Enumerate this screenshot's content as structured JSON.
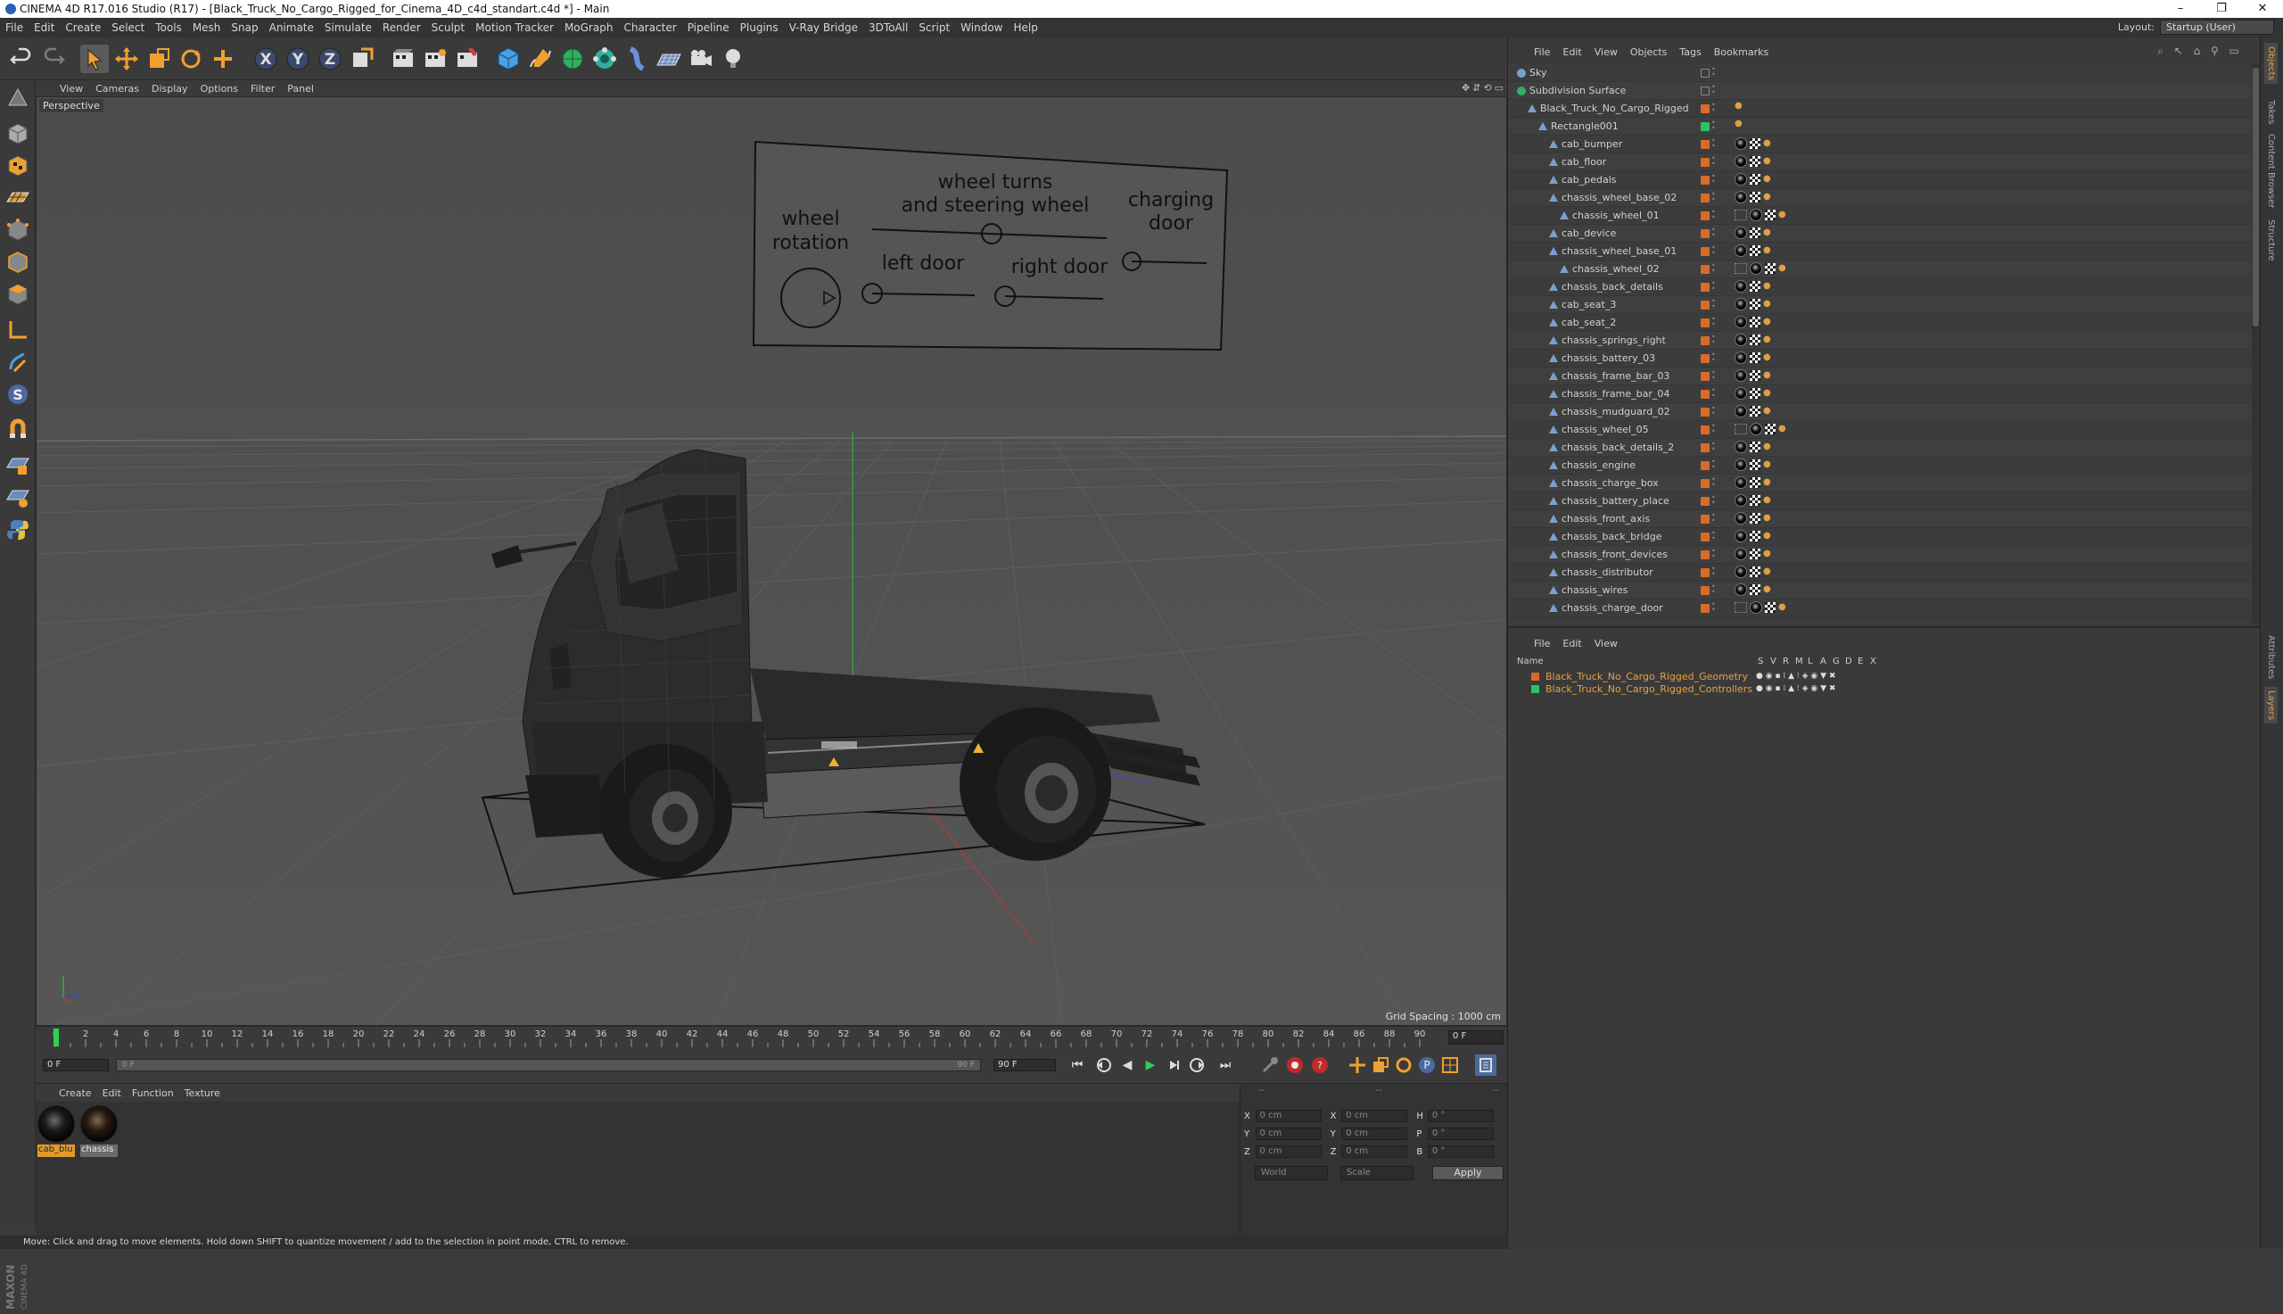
{
  "window": {
    "title": "CINEMA 4D R17.016 Studio (R17) - [Black_Truck_No_Cargo_Rigged_for_Cinema_4D_c4d_standart.c4d *] - Main",
    "controls": [
      "–",
      "❐",
      "✕"
    ]
  },
  "menubar": {
    "items": [
      "File",
      "Edit",
      "Create",
      "Select",
      "Tools",
      "Mesh",
      "Snap",
      "Animate",
      "Simulate",
      "Render",
      "Sculpt",
      "Motion Tracker",
      "MoGraph",
      "Character",
      "Pipeline",
      "Plugins",
      "V-Ray Bridge",
      "3DToAll",
      "Script",
      "Window",
      "Help"
    ],
    "layout_label": "Layout:",
    "layout_value": "Startup (User)"
  },
  "toolbar": {
    "icons": [
      "undo-icon",
      "redo-icon",
      "select-arrow-icon",
      "move-icon",
      "scale-icon",
      "rotate-icon",
      "add-icon",
      "x-axis-icon",
      "y-axis-icon",
      "z-axis-icon",
      "world-coords-icon",
      "render-view-icon",
      "render-picture-viewer-icon",
      "edit-render-settings-icon",
      "cube-icon",
      "pen-spline-icon",
      "subdivision-icon",
      "array-icon",
      "deformer-icon",
      "floor-icon",
      "camera-icon",
      "light-icon"
    ],
    "axis_labels": [
      "X",
      "Y",
      "Z"
    ]
  },
  "lefttools": {
    "icons": [
      "make-editable-icon",
      "model-mode-icon",
      "texture-mode-icon",
      "workplane-icon",
      "points-mode-icon",
      "edges-mode-icon",
      "polygons-mode-icon",
      "axis-icon",
      "tweak-icon",
      "solo-icon",
      "snap-icon",
      "lock-workplane-icon",
      "grid-snap-icon",
      "python-icon"
    ]
  },
  "maxon_logo": "MAXON CINEMA 4D",
  "viewport": {
    "menu": [
      "View",
      "Cameras",
      "Display",
      "Options",
      "Filter",
      "Panel"
    ],
    "nav_icons": [
      "✥",
      "⇵",
      "⟲",
      "▭"
    ],
    "label": "Perspective",
    "grid_spacing": "Grid Spacing : 1000 cm",
    "controller_panel": {
      "wheel_rotation": "wheel\nrotation",
      "wheel_turns": "wheel turns\nand steering wheel",
      "charging_door": "charging\ndoor",
      "left_door": "left door",
      "right_door": "right door"
    }
  },
  "timeline": {
    "ticks": [
      "0",
      "2",
      "4",
      "6",
      "8",
      "10",
      "12",
      "14",
      "16",
      "18",
      "20",
      "22",
      "24",
      "26",
      "28",
      "30",
      "32",
      "34",
      "36",
      "38",
      "40",
      "42",
      "44",
      "46",
      "48",
      "50",
      "52",
      "54",
      "56",
      "58",
      "60",
      "62",
      "64",
      "66",
      "68",
      "70",
      "72",
      "74",
      "76",
      "78",
      "80",
      "82",
      "84",
      "86",
      "88",
      "90"
    ],
    "current_frame": "0 F"
  },
  "transport": {
    "start_field": "0 F",
    "scrub_start": "0 F",
    "scrub_end": "90 F",
    "end_field": "90 F",
    "buttons": [
      "⏮",
      "◀◀",
      "◀",
      "▶",
      "▶▶",
      "⏭",
      "⟳"
    ]
  },
  "material_manager": {
    "menu": [
      "Create",
      "Edit",
      "Function",
      "Texture"
    ],
    "materials": [
      {
        "label": "cab_blu"
      },
      {
        "label": "chassis"
      }
    ]
  },
  "coordinates": {
    "header": [
      "--",
      "--",
      "--"
    ],
    "rows": [
      {
        "l1": "X",
        "v1": "0 cm",
        "l2": "X",
        "v2": "0 cm",
        "l3": "H",
        "v3": "0 °"
      },
      {
        "l1": "Y",
        "v1": "0 cm",
        "l2": "Y",
        "v2": "0 cm",
        "l3": "P",
        "v3": "0 °"
      },
      {
        "l1": "Z",
        "v1": "0 cm",
        "l2": "Z",
        "v2": "0 cm",
        "l3": "B",
        "v3": "0 °"
      }
    ],
    "dropdown1": "World",
    "dropdown2": "Scale",
    "apply": "Apply"
  },
  "statusbar": "Move: Click and drag to move elements. Hold down SHIFT to quantize movement / add to the selection in point mode, CTRL to remove.",
  "object_manager": {
    "menu": [
      "File",
      "Edit",
      "View",
      "Objects",
      "Tags",
      "Bookmarks"
    ],
    "objects": [
      {
        "name": "Sky",
        "indent": 0,
        "color": "",
        "tags": "none"
      },
      {
        "name": "Subdivision Surface",
        "indent": 0,
        "color": "",
        "tags": "none"
      },
      {
        "name": "Black_Truck_No_Cargo_Rigged",
        "indent": 1,
        "color": "#d96b28",
        "tags": "sm"
      },
      {
        "name": "Rectangle001",
        "indent": 2,
        "color": "#29c26a",
        "tags": "sm"
      },
      {
        "name": "cab_bumper",
        "indent": 3,
        "color": "#d96b28",
        "tags": "mat"
      },
      {
        "name": "cab_floor",
        "indent": 3,
        "color": "#d96b28",
        "tags": "mat"
      },
      {
        "name": "cab_pedals",
        "indent": 3,
        "color": "#d96b28",
        "tags": "mat"
      },
      {
        "name": "chassis_wheel_base_02",
        "indent": 3,
        "color": "#d96b28",
        "tags": "mat"
      },
      {
        "name": "chassis_wheel_01",
        "indent": 4,
        "color": "#d96b28",
        "tags": "grid"
      },
      {
        "name": "cab_device",
        "indent": 3,
        "color": "#d96b28",
        "tags": "mat"
      },
      {
        "name": "chassis_wheel_base_01",
        "indent": 3,
        "color": "#d96b28",
        "tags": "mat"
      },
      {
        "name": "chassis_wheel_02",
        "indent": 4,
        "color": "#d96b28",
        "tags": "grid"
      },
      {
        "name": "chassis_back_details",
        "indent": 3,
        "color": "#d96b28",
        "tags": "mat"
      },
      {
        "name": "cab_seat_3",
        "indent": 3,
        "color": "#d96b28",
        "tags": "mat"
      },
      {
        "name": "cab_seat_2",
        "indent": 3,
        "color": "#d96b28",
        "tags": "mat"
      },
      {
        "name": "chassis_springs_right",
        "indent": 3,
        "color": "#d96b28",
        "tags": "mat"
      },
      {
        "name": "chassis_battery_03",
        "indent": 3,
        "color": "#d96b28",
        "tags": "mat"
      },
      {
        "name": "chassis_frame_bar_03",
        "indent": 3,
        "color": "#d96b28",
        "tags": "mat"
      },
      {
        "name": "chassis_frame_bar_04",
        "indent": 3,
        "color": "#d96b28",
        "tags": "mat"
      },
      {
        "name": "chassis_mudguard_02",
        "indent": 3,
        "color": "#d96b28",
        "tags": "mat"
      },
      {
        "name": "chassis_wheel_05",
        "indent": 3,
        "color": "#d96b28",
        "tags": "grid"
      },
      {
        "name": "chassis_back_details_2",
        "indent": 3,
        "color": "#d96b28",
        "tags": "mat"
      },
      {
        "name": "chassis_engine",
        "indent": 3,
        "color": "#d96b28",
        "tags": "mat"
      },
      {
        "name": "chassis_charge_box",
        "indent": 3,
        "color": "#d96b28",
        "tags": "mat"
      },
      {
        "name": "chassis_battery_place",
        "indent": 3,
        "color": "#d96b28",
        "tags": "mat"
      },
      {
        "name": "chassis_front_axis",
        "indent": 3,
        "color": "#d96b28",
        "tags": "mat"
      },
      {
        "name": "chassis_back_bridge",
        "indent": 3,
        "color": "#d96b28",
        "tags": "mat"
      },
      {
        "name": "chassis_front_devices",
        "indent": 3,
        "color": "#d96b28",
        "tags": "mat"
      },
      {
        "name": "chassis_distributor",
        "indent": 3,
        "color": "#d96b28",
        "tags": "mat"
      },
      {
        "name": "chassis_wires",
        "indent": 3,
        "color": "#d96b28",
        "tags": "mat"
      },
      {
        "name": "chassis_charge_door",
        "indent": 3,
        "color": "#d96b28",
        "tags": "grid"
      }
    ]
  },
  "layer_manager": {
    "menu": [
      "File",
      "Edit",
      "View"
    ],
    "columns": [
      "Name",
      "S",
      "V",
      "R",
      "M",
      "L",
      "A",
      "G",
      "D",
      "E",
      "X"
    ],
    "layers": [
      {
        "name": "Black_Truck_No_Cargo_Rigged_Geometry",
        "color": "#d96b28"
      },
      {
        "name": "Black_Truck_No_Cargo_Rigged_Controllers",
        "color": "#29c26a"
      }
    ]
  },
  "right_tabs": [
    "Objects",
    "Takes",
    "Content Browser",
    "Structure",
    "Attributes",
    "Layers"
  ]
}
